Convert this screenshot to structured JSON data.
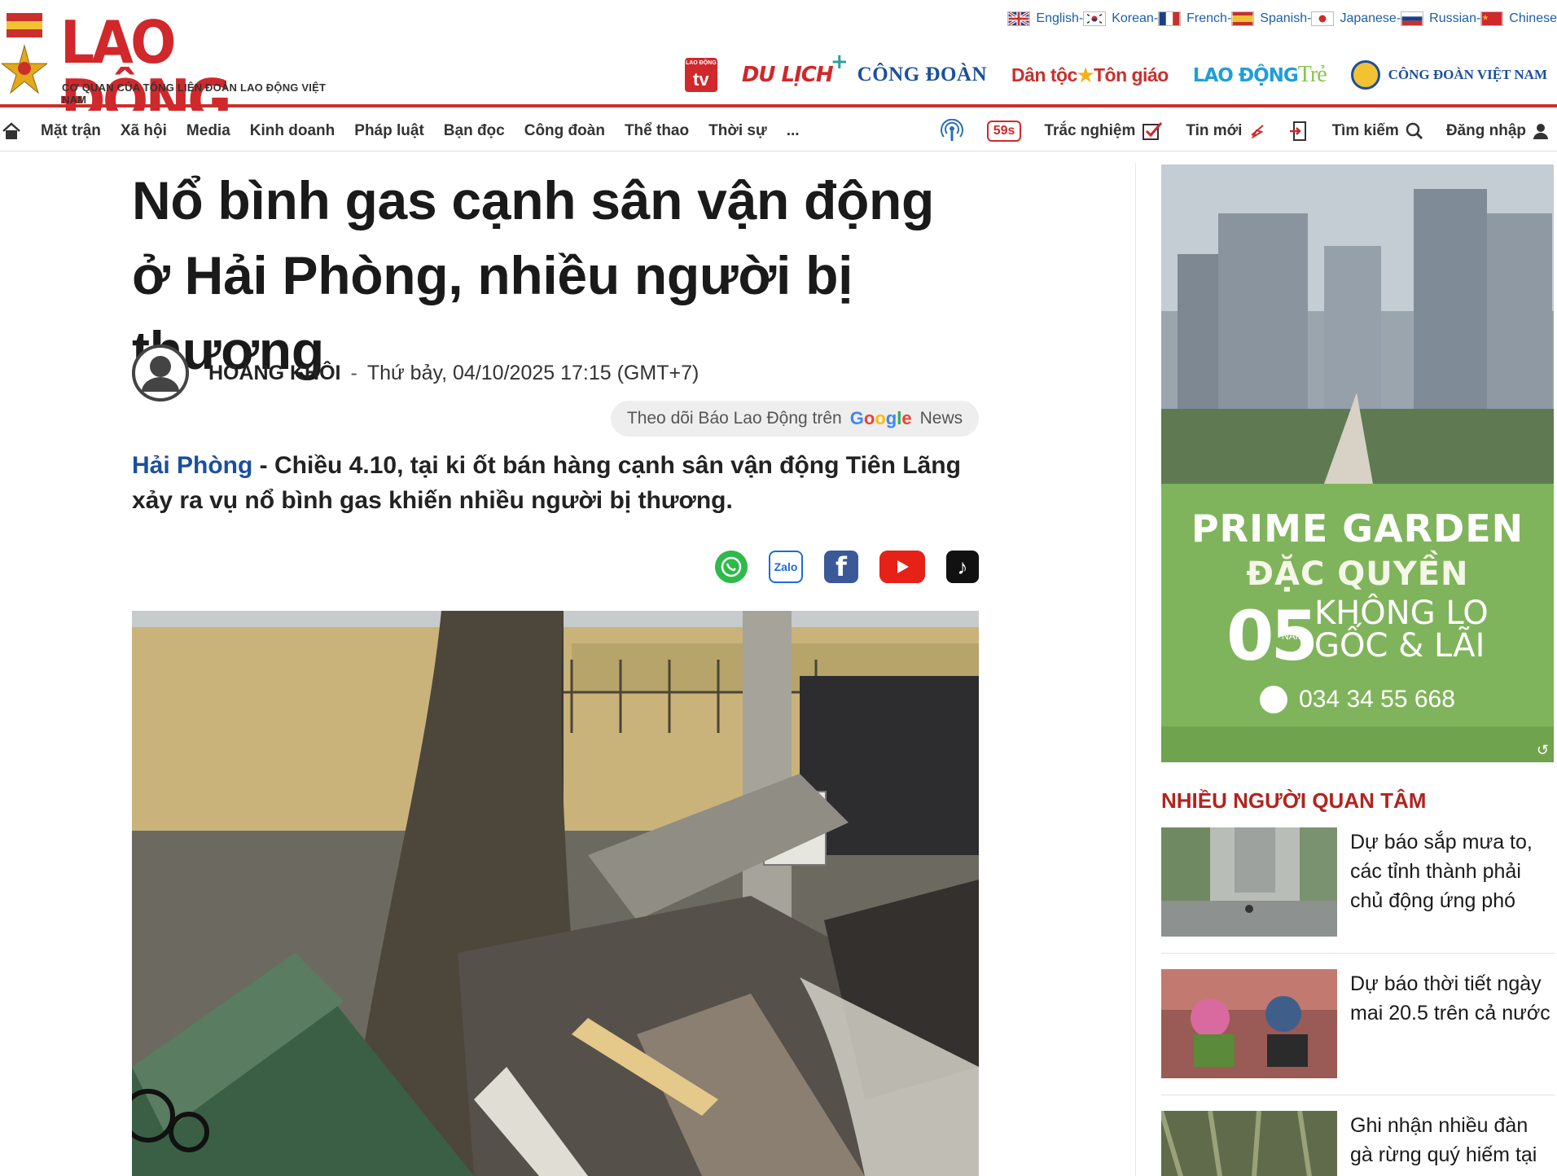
{
  "header": {
    "logo_text": "LAO ĐỘNG",
    "logo_sub": "CƠ QUAN CỦA TỔNG LIÊN ĐOÀN LAO ĐỘNG VIỆT NAM",
    "languages": [
      "English",
      "Korean",
      "French",
      "Spanish",
      "Japanese",
      "Russian",
      "Chinese"
    ],
    "brands": {
      "tv": "tv",
      "tv_mini": "LAO ĐỘNG",
      "dulich": "DU LỊCH",
      "congdoan": "CÔNG ĐOÀN",
      "dantoc_a": "Dân tộc",
      "dantoc_b": "Tôn giáo",
      "ldtre_a": "LAO ĐỘNG",
      "ldtre_b": "Trẻ",
      "cdvn": "CÔNG ĐOÀN VIỆT NAM"
    }
  },
  "nav": {
    "items": [
      "Mặt trận",
      "Xã hội",
      "Media",
      "Kinh doanh",
      "Pháp luật",
      "Bạn đọc",
      "Công đoàn",
      "Thể thao",
      "Thời sự",
      "..."
    ],
    "badge": "59s",
    "quiz": "Trắc nghiệm",
    "latest": "Tin mới",
    "search": "Tìm kiếm",
    "login": "Đăng nhập"
  },
  "article": {
    "title": "Nổ bình gas cạnh sân vận động ở Hải Phòng, nhiều người bị thương",
    "author": "HOÀNG KHÔI",
    "separator": "-",
    "date": "Thứ bảy, 04/10/2025 17:15 (GMT+7)",
    "gnews_text": "Theo dõi Báo Lao Động trên",
    "gnews_news": "News",
    "sapo_location": "Hải Phòng",
    "sapo_text": " - Chiều 4.10, tại ki ốt bán hàng cạnh sân vận động Tiên Lãng xảy ra vụ nổ bình gas khiến nhiều người bị thương."
  },
  "share": {
    "zalo": "Zalo",
    "facebook": "f",
    "tiktok": "♪"
  },
  "ad": {
    "line1": "PRIME GARDEN",
    "line2": "ĐẶC QUYỀN",
    "num": "05",
    "num_unit": "NĂM",
    "k1": "KHÔNG LO",
    "k2": "GỐC & LÃI",
    "phone": "034 34 55 668",
    "replay": "↺"
  },
  "sidebar": {
    "heading": "NHIỀU NGƯỜI QUAN TÂM",
    "items": [
      {
        "title": "Dự báo sắp mưa to, các tỉnh thành phải chủ động ứng phó"
      },
      {
        "title": "Dự báo thời tiết ngày mai 20.5 trên cả nước"
      },
      {
        "title": "Ghi nhận nhiều đàn gà rừng quý hiếm tại"
      }
    ]
  }
}
